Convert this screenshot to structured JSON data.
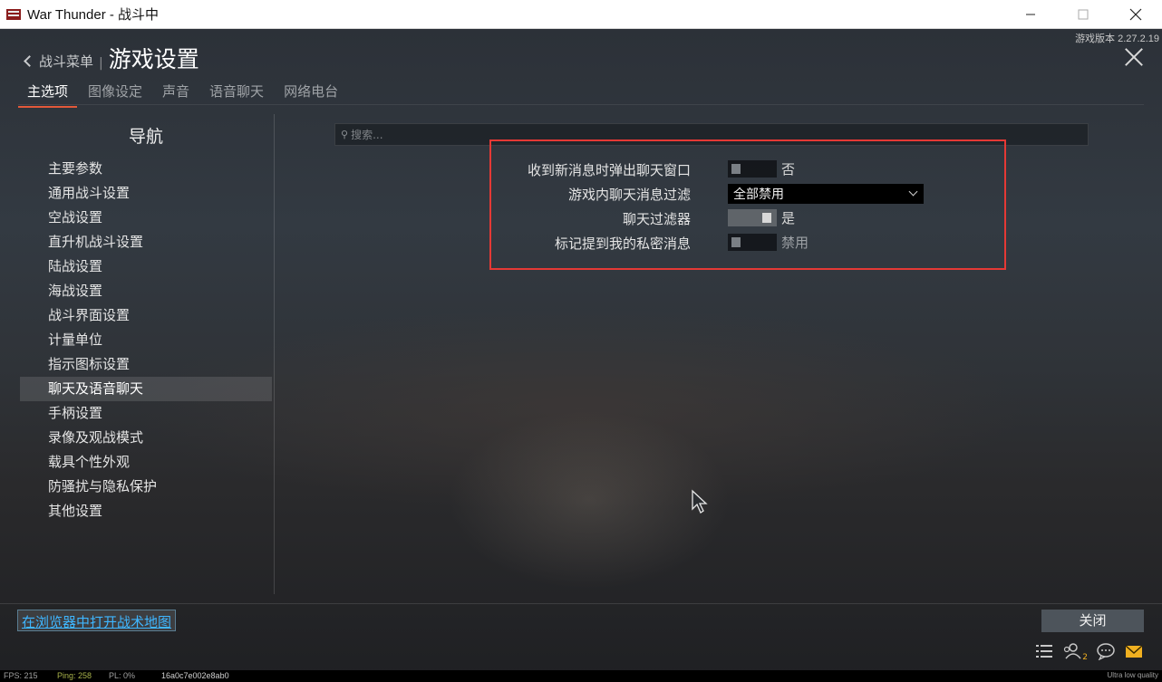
{
  "window": {
    "title": "War Thunder - 战斗中"
  },
  "header": {
    "version": "游戏版本 2.27.2.19",
    "back_label": "战斗菜单",
    "separator": "|",
    "page_title": "游戏设置"
  },
  "tabs": [
    {
      "label": "主选项"
    },
    {
      "label": "图像设定"
    },
    {
      "label": "声音"
    },
    {
      "label": "语音聊天"
    },
    {
      "label": "网络电台"
    }
  ],
  "nav": {
    "title": "导航",
    "items": [
      {
        "label": "主要参数"
      },
      {
        "label": "通用战斗设置"
      },
      {
        "label": "空战设置"
      },
      {
        "label": "直升机战斗设置"
      },
      {
        "label": "陆战设置"
      },
      {
        "label": "海战设置"
      },
      {
        "label": "战斗界面设置"
      },
      {
        "label": "计量单位"
      },
      {
        "label": "指示图标设置"
      },
      {
        "label": "聊天及语音聊天"
      },
      {
        "label": "手柄设置"
      },
      {
        "label": "录像及观战模式"
      },
      {
        "label": "载具个性外观"
      },
      {
        "label": "防骚扰与隐私保护"
      },
      {
        "label": "其他设置"
      }
    ],
    "selected_index": 9
  },
  "search": {
    "placeholder": "搜索..."
  },
  "settings": {
    "highlight_color": "#e53935",
    "rows": [
      {
        "label": "收到新消息时弹出聊天窗口",
        "type": "toggle",
        "on": false,
        "value": "否"
      },
      {
        "label": "游戏内聊天消息过滤",
        "type": "select",
        "value": "全部禁用"
      },
      {
        "label": "聊天过滤器",
        "type": "toggle",
        "on": true,
        "value": "是"
      },
      {
        "label": "标记提到我的私密消息",
        "type": "toggle",
        "on": false,
        "value": "禁用"
      }
    ]
  },
  "bottom": {
    "map_link": "在浏览器中打开战术地图",
    "close_button": "关闭"
  },
  "footer": {
    "friends_count": "2"
  },
  "status": {
    "fps": "FPS: 215",
    "ping": "Ping: 258",
    "pl": "PL: 0%",
    "session": "16a0c7e002e8ab0",
    "quality": "Ultra low quality"
  },
  "colors": {
    "accent_tab": "#e2583a",
    "link": "#3fb6ff",
    "ping_color": "#a8b24a",
    "mail_icon": "#f0b020"
  }
}
